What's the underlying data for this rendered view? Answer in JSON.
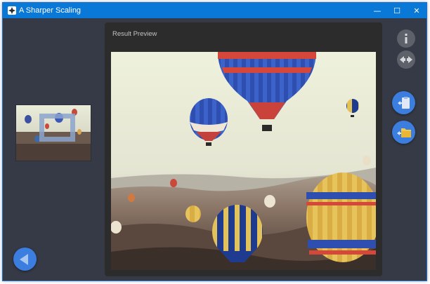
{
  "window": {
    "title": "A Sharper Scaling",
    "caption": {
      "minimize": "—",
      "maximize": "☐",
      "close": "✕"
    }
  },
  "preview": {
    "title": "Result Preview"
  },
  "icons": {
    "app": "app-icon",
    "back": "arrow-left-icon",
    "info": "info-icon",
    "compare": "compare-arrows-icon",
    "copy": "clipboard-icon",
    "save": "folder-icon"
  },
  "colors": {
    "titlebar": "#0a78d7",
    "background": "#353a46",
    "panel": "#2c2c2c",
    "accent_button": "#3b7ee0",
    "gray_button": "#5d6169"
  }
}
